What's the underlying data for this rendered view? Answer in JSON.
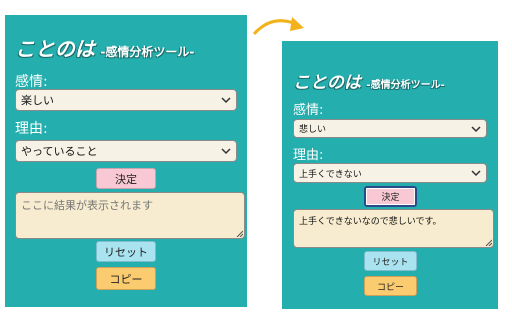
{
  "before": {
    "title": "ことのは",
    "subtitle": "-感情分析ツール-",
    "emotion_label": "感情:",
    "emotion_value": "楽しい",
    "reason_label": "理由:",
    "reason_value": "やっていること",
    "decide_label": "決定",
    "result_placeholder": "ここに結果が表示されます",
    "reset_label": "リセット",
    "copy_label": "コピー"
  },
  "after": {
    "title": "ことのは",
    "subtitle": "-感情分析ツール-",
    "emotion_label": "感情:",
    "emotion_value": "悲しい",
    "reason_label": "理由:",
    "reason_value": "上手くできない",
    "decide_label": "決定",
    "result_text": "上手くできないなので悲しいです。",
    "reset_label": "リセット",
    "copy_label": "コピー"
  },
  "colors": {
    "panel": "#24aeae",
    "decide_button": "#f8c8d4",
    "reset_button": "#a9e3ef",
    "copy_button": "#fbcb70",
    "textarea": "#f7eccf",
    "arrow": "#f3b21a"
  },
  "icons": {
    "transition_arrow": "curved-arrow-right-icon",
    "select_chevron": "chevron-down-icon",
    "textarea_resize": "resize-grip-icon"
  }
}
